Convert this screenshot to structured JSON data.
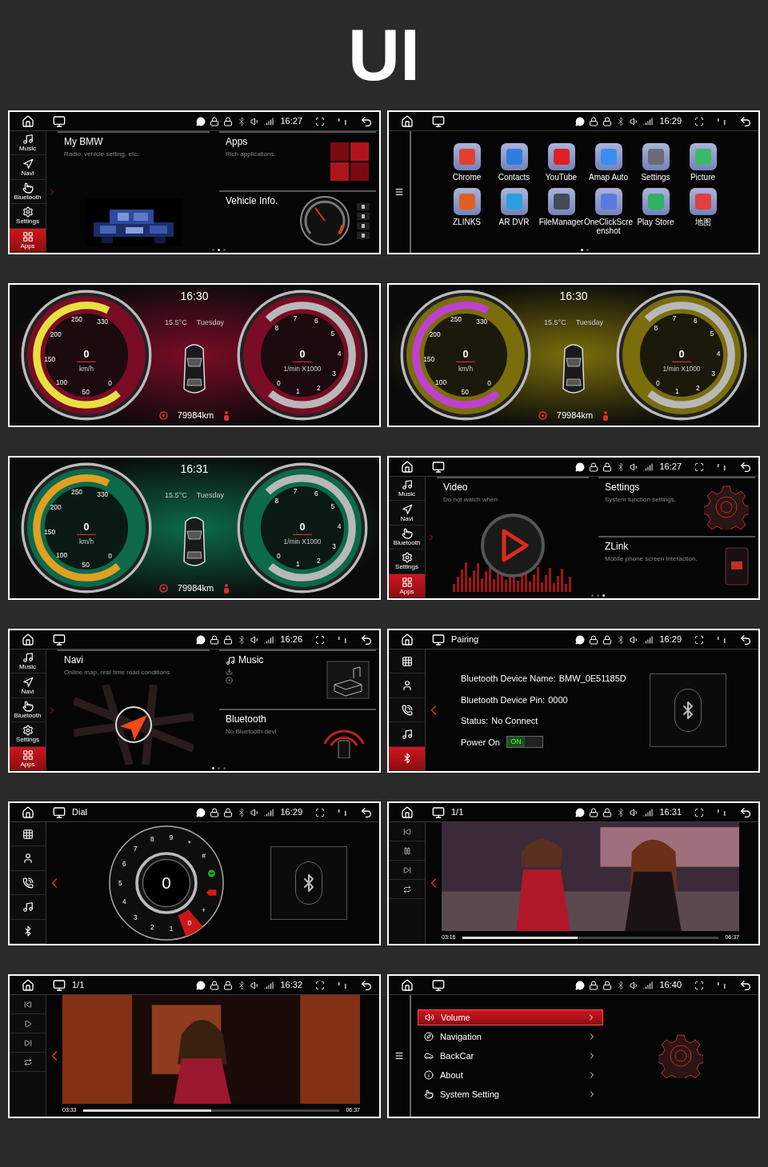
{
  "title": "UI",
  "screens": [
    {
      "kind": "home",
      "time": "16:27",
      "sidebar": [
        {
          "kind": "music",
          "label": "Music",
          "selected": false
        },
        {
          "kind": "navi",
          "label": "Navi",
          "selected": false
        },
        {
          "kind": "bluetooth",
          "label": "Bluetooth",
          "selected": false
        },
        {
          "kind": "settings",
          "label": "Settings",
          "selected": false
        },
        {
          "kind": "apps",
          "label": "Apps",
          "selected": true
        }
      ],
      "cards": [
        {
          "kind": "car",
          "title": "My BMW",
          "subtitle": "Radio, vehicle setting, etc."
        },
        {
          "kind": "tiles",
          "title": "Apps",
          "subtitle": "Rich applications."
        },
        {
          "kind": "gauge",
          "title": "Vehicle Info."
        }
      ],
      "dots": [
        {
          "selected": false
        },
        {
          "selected": true
        },
        {
          "selected": false
        }
      ]
    },
    {
      "kind": "apps",
      "time": "16:29",
      "apps": [
        {
          "label": "Chrome",
          "color": "#e04030"
        },
        {
          "label": "Contacts",
          "color": "#2f7de0"
        },
        {
          "label": "YouTube",
          "color": "#e02020"
        },
        {
          "label": "Amap Auto",
          "color": "#3a8ef0"
        },
        {
          "label": "Settings",
          "color": "#6b6b7a"
        },
        {
          "label": "Picture",
          "color": "#3cb86a"
        },
        {
          "label": "ZLINKS",
          "color": "#e06020"
        },
        {
          "label": "AR DVR",
          "color": "#2aa0e0"
        },
        {
          "label": "FileManager",
          "color": "#444a5a"
        },
        {
          "label": "OneClickScreenshot",
          "color": "#5a7ae0"
        },
        {
          "label": "Play Store",
          "color": "#30b060"
        },
        {
          "label": "地图",
          "color": "#e04040"
        }
      ],
      "dots": [
        {
          "selected": true
        },
        {
          "selected": false
        }
      ]
    },
    {
      "kind": "cluster",
      "time": "16:30",
      "weather": "15.5°C",
      "day": "Tuesday",
      "odometer": "79984km",
      "color": "#7a0c25",
      "arc": {
        "color": "#e8e040"
      },
      "speed": {
        "reading": "0",
        "unit": "km/h",
        "labels": [
          "0",
          "50",
          "100",
          "150",
          "200",
          "250",
          "330"
        ]
      },
      "rpm": {
        "reading": "0",
        "unit": "1/min X1000",
        "labels": [
          "0",
          "1",
          "2",
          "3",
          "4",
          "5",
          "6",
          "7",
          "8"
        ]
      }
    },
    {
      "kind": "cluster",
      "time": "16:30",
      "weather": "15.5°C",
      "day": "Tuesday",
      "odometer": "79984km",
      "color": "#7a6e0c",
      "arc": {
        "color": "#c040d0"
      },
      "speed": {
        "reading": "0",
        "unit": "km/h",
        "labels": [
          "0",
          "50",
          "100",
          "150",
          "200",
          "250",
          "330"
        ]
      },
      "rpm": {
        "reading": "0",
        "unit": "1/min X1000",
        "labels": [
          "0",
          "1",
          "2",
          "3",
          "4",
          "5",
          "6",
          "7",
          "8"
        ]
      }
    },
    {
      "kind": "cluster",
      "time": "16:31",
      "weather": "15.5°C",
      "day": "Tuesday",
      "odometer": "79984km",
      "color": "#0c6a4a",
      "arc": {
        "color": "#e0a020"
      },
      "speed": {
        "reading": "0",
        "unit": "km/h",
        "labels": [
          "0",
          "50",
          "100",
          "150",
          "200",
          "250",
          "330"
        ]
      },
      "rpm": {
        "reading": "0",
        "unit": "1/min X1000",
        "labels": [
          "0",
          "1",
          "2",
          "3",
          "4",
          "5",
          "6",
          "7",
          "8"
        ]
      }
    },
    {
      "kind": "home",
      "time": "16:27",
      "sidebar": [
        {
          "kind": "music",
          "label": "Music",
          "selected": false
        },
        {
          "kind": "navi",
          "label": "Navi",
          "selected": false
        },
        {
          "kind": "bluetooth",
          "label": "Bluetooth",
          "selected": false
        },
        {
          "kind": "settings",
          "label": "Settings",
          "selected": false
        },
        {
          "kind": "apps",
          "label": "Apps",
          "selected": true
        }
      ],
      "cards": [
        {
          "kind": "play",
          "title": "Video",
          "subtitle": "Do not watch when"
        },
        {
          "kind": "gear",
          "title": "Settings",
          "subtitle": "System function settings."
        },
        {
          "kind": "phone",
          "title": "ZLink",
          "subtitle": "Mobile phone screen interaction."
        }
      ],
      "dots": [
        {
          "selected": false
        },
        {
          "selected": false
        },
        {
          "selected": true
        }
      ]
    },
    {
      "kind": "home",
      "time": "16:26",
      "sidebar": [
        {
          "kind": "music",
          "label": "Music",
          "selected": false
        },
        {
          "kind": "navi",
          "label": "Navi",
          "selected": false
        },
        {
          "kind": "bluetooth",
          "label": "Bluetooth",
          "selected": false
        },
        {
          "kind": "settings",
          "label": "Settings",
          "selected": false
        },
        {
          "kind": "apps",
          "label": "Apps",
          "selected": true
        }
      ],
      "cards": [
        {
          "kind": "map",
          "title": "Navi",
          "subtitle": "Online map, real time road conditions"
        },
        {
          "kind": "music",
          "title": "Music"
        },
        {
          "kind": "signal",
          "title": "Bluetooth",
          "subtitle": "No Bluetooth devi"
        }
      ],
      "dots": [
        {
          "selected": true
        },
        {
          "selected": false
        },
        {
          "selected": false
        }
      ]
    },
    {
      "kind": "pairing",
      "time": "16:29",
      "heading": "Pairing",
      "sidebar": [
        {
          "kind": "keypad",
          "selected": false
        },
        {
          "kind": "contacts",
          "selected": false
        },
        {
          "kind": "calls",
          "selected": false
        },
        {
          "kind": "music",
          "selected": false
        },
        {
          "kind": "bluetooth",
          "selected": true
        }
      ],
      "fields": [
        {
          "label": "Bluetooth Device Name:",
          "value": "BMW_0E51185D"
        },
        {
          "label": "Bluetooth Device Pin:",
          "value": "0000"
        },
        {
          "label": "Status:",
          "value": "No Connect"
        }
      ],
      "power": {
        "label": "Power On",
        "on": true,
        "text": "ON"
      }
    },
    {
      "kind": "dial",
      "time": "16:29",
      "heading": "Dial",
      "display": "0",
      "sidebar": [
        {
          "kind": "keypad",
          "selected": false
        },
        {
          "kind": "contacts",
          "selected": false
        },
        {
          "kind": "calls",
          "selected": false
        },
        {
          "kind": "music",
          "selected": false
        },
        {
          "kind": "bluetooth",
          "selected": false
        }
      ],
      "keys": [
        {
          "kind": "text",
          "label": "1",
          "selected": false
        },
        {
          "kind": "text",
          "label": "2",
          "selected": false
        },
        {
          "kind": "text",
          "label": "3",
          "selected": false
        },
        {
          "kind": "text",
          "label": "4",
          "selected": false
        },
        {
          "kind": "text",
          "label": "5",
          "selected": false
        },
        {
          "kind": "text",
          "label": "6",
          "selected": false
        },
        {
          "kind": "text",
          "label": "7",
          "selected": false
        },
        {
          "kind": "text",
          "label": "8",
          "selected": false
        },
        {
          "kind": "text",
          "label": "9",
          "selected": false
        },
        {
          "kind": "text",
          "label": "*",
          "selected": false
        },
        {
          "kind": "text",
          "label": "#",
          "selected": false
        },
        {
          "kind": "call",
          "selected": false
        },
        {
          "kind": "delete",
          "selected": false
        },
        {
          "kind": "text",
          "label": "+",
          "selected": false
        },
        {
          "kind": "text",
          "label": "0",
          "selected": true
        }
      ]
    },
    {
      "kind": "video",
      "time": "16:31",
      "heading": "1/1",
      "sidebar": [
        {
          "kind": "prev"
        },
        {
          "kind": "pause"
        },
        {
          "kind": "next"
        },
        {
          "kind": "repeat"
        }
      ],
      "elapsed": "03:16",
      "total": "06:37",
      "level": 0.45
    },
    {
      "kind": "video",
      "time": "16:32",
      "heading": "1/1",
      "sidebar": [
        {
          "kind": "prev"
        },
        {
          "kind": "play"
        },
        {
          "kind": "next"
        },
        {
          "kind": "repeat"
        }
      ],
      "elapsed": "03:33",
      "total": "06:37",
      "level": 0.5
    },
    {
      "kind": "settings",
      "time": "16:40",
      "menu": [
        {
          "kind": "volume",
          "label": "Volume",
          "selected": true
        },
        {
          "kind": "navigation",
          "label": "Navigation",
          "selected": false
        },
        {
          "kind": "backcar",
          "label": "BackCar",
          "selected": false
        },
        {
          "kind": "about",
          "label": "About",
          "selected": false
        },
        {
          "kind": "system",
          "label": "System Setting",
          "selected": false
        }
      ]
    }
  ]
}
